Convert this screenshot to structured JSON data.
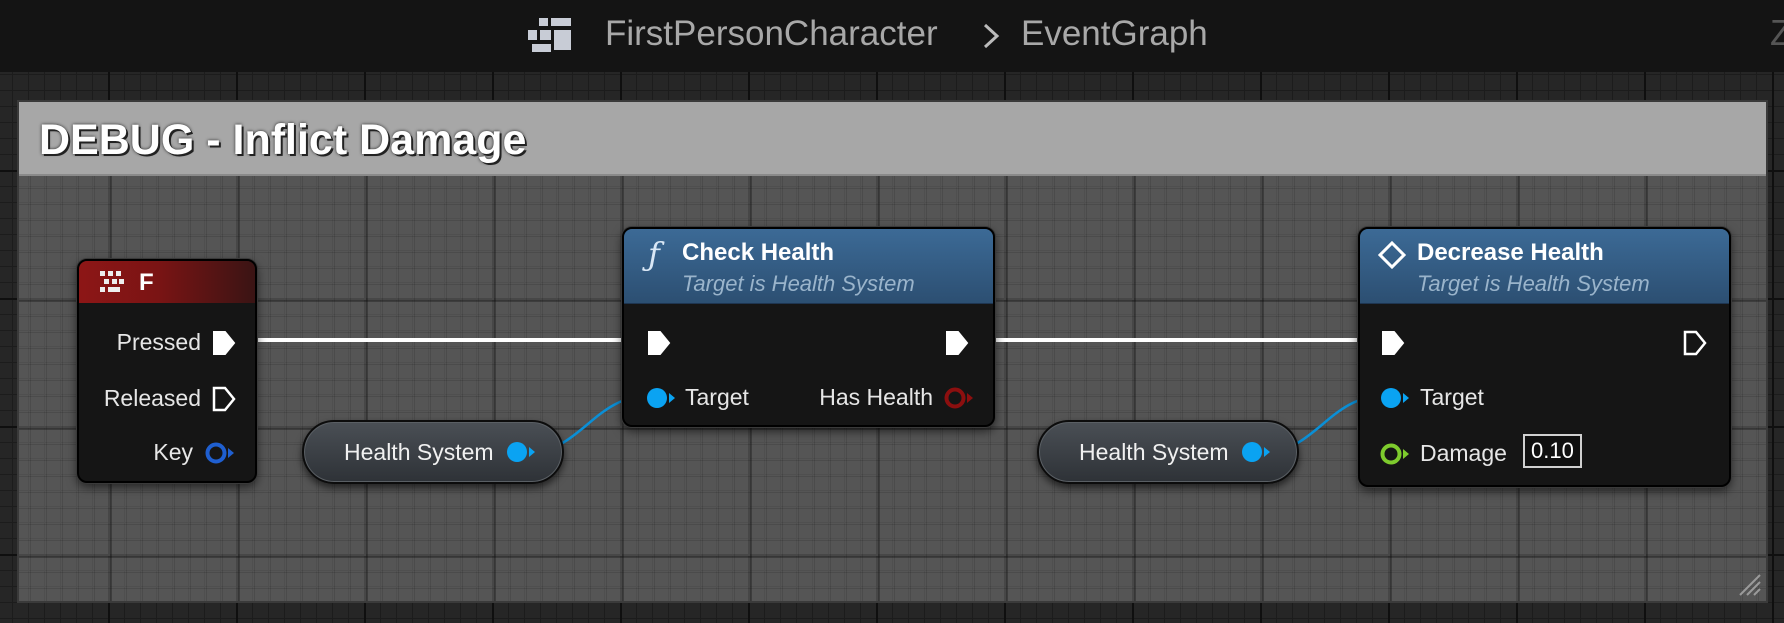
{
  "breadcrumb": {
    "blueprint": "FirstPersonCharacter",
    "graph": "EventGraph",
    "zoom_text": "Z"
  },
  "comment": {
    "title": "DEBUG - Inflict Damage"
  },
  "nodes": {
    "key_event": {
      "title": "F",
      "pins": {
        "pressed": "Pressed",
        "released": "Released",
        "key": "Key"
      }
    },
    "check_health": {
      "title": "Check Health",
      "subtitle": "Target is Health System",
      "pins": {
        "target": "Target",
        "has_health": "Has Health"
      }
    },
    "decrease_health": {
      "title": "Decrease Health",
      "subtitle": "Target is Health System",
      "pins": {
        "target": "Target",
        "damage": "Damage"
      },
      "damage_default": "0.10"
    }
  },
  "getters": {
    "first": "Health System",
    "second": "Health System"
  },
  "colors": {
    "object_pin": "#0aa3f2",
    "float_pin": "#7ecb2d",
    "bool_pin": "#8c0f0f",
    "exec_pin": "#ffffff",
    "key_pin": "#1f5fd0",
    "event_header": "#8d1616",
    "function_header": "#3c6a96"
  },
  "icons": {
    "graph": "blueprint-graph-icon",
    "separator": "chevron-right-icon",
    "key_event": "keyboard-key-icon",
    "function": "function-f-icon",
    "latent": "diamond-icon"
  }
}
